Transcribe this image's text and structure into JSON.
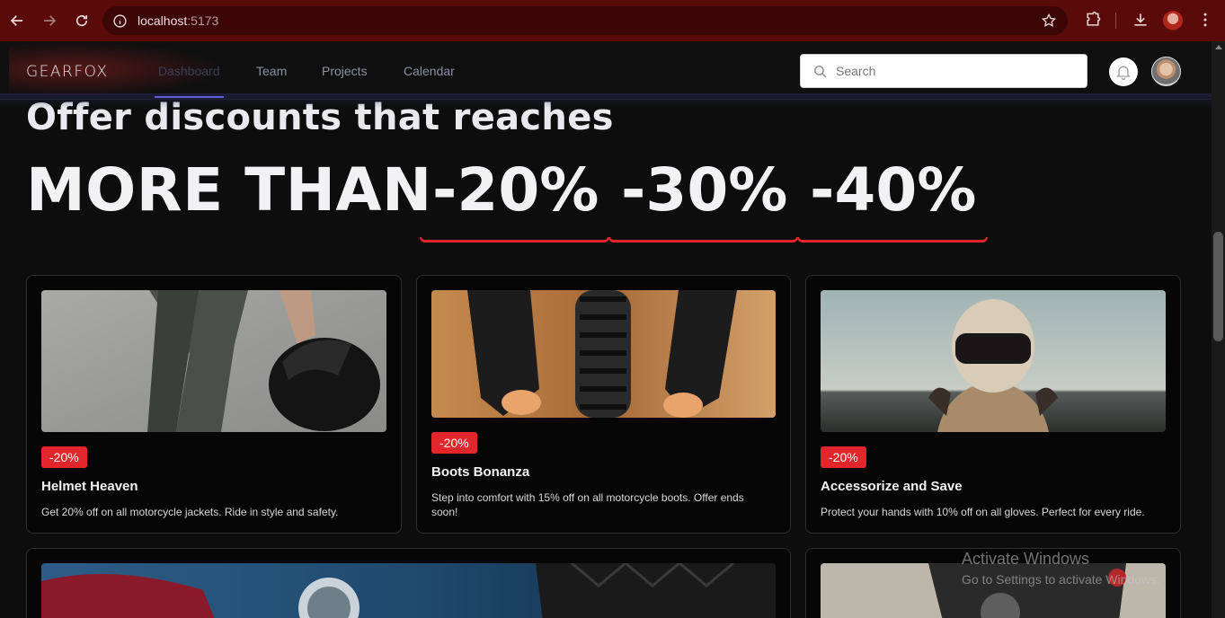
{
  "browser": {
    "url_host": "localhost",
    "url_port": ":5173"
  },
  "app": {
    "logo": "GEARFOX",
    "nav": [
      {
        "label": "Dashboard",
        "active": true
      },
      {
        "label": "Team",
        "active": false
      },
      {
        "label": "Projects",
        "active": false
      },
      {
        "label": "Calendar",
        "active": false
      }
    ],
    "search_placeholder": "Search"
  },
  "hero": {
    "line1": "Offer discounts that reaches",
    "line2": "MORE THAN",
    "discounts": [
      "-20%",
      "-30%",
      "-40%"
    ],
    "accent_color": "#e3262b"
  },
  "cards": [
    {
      "badge": "-20%",
      "title": "Helmet Heaven",
      "description": "Get 20% off on all motorcycle jackets. Ride in style and safety."
    },
    {
      "badge": "-20%",
      "title": "Boots Bonanza",
      "description": "Step into comfort with 15% off on all motorcycle boots. Offer ends soon!"
    },
    {
      "badge": "-20%",
      "title": "Accessorize and Save",
      "description": "Protect your hands with 10% off on all gloves. Perfect for every ride."
    }
  ],
  "watermark": {
    "title": "Activate Windows",
    "subtitle": "Go to Settings to activate Windows."
  }
}
